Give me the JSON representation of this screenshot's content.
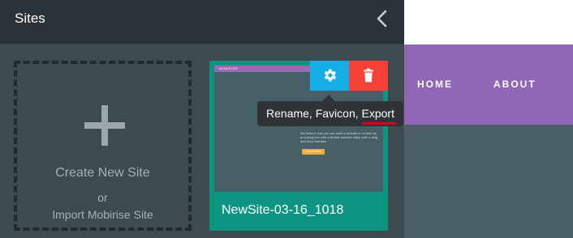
{
  "panel": {
    "title": "Sites",
    "back_icon": "chevron-left-icon"
  },
  "create_tile": {
    "icon": "plus-icon",
    "label": "Create New Site",
    "or": "or",
    "import_label": "Import Mobirise Site"
  },
  "site_card": {
    "name": "NewSite-03-16_1018",
    "thumb_brand": "MOBIRISE",
    "thumb_text": "We believe that you can build a website in no time by providing you with a flexible website editor with a drag and drop interface.",
    "thumb_button": "LEARN MORE",
    "settings_icon": "gear-icon",
    "delete_icon": "trash-icon"
  },
  "tooltip": {
    "text": "Rename, Favicon, Export"
  },
  "preview": {
    "nav_items": [
      "HOME",
      "ABOUT"
    ]
  },
  "colors": {
    "accent_blue": "#16aee6",
    "delete_red": "#f44336",
    "card_teal": "#0e9482",
    "nav_purple": "#9066b7"
  }
}
